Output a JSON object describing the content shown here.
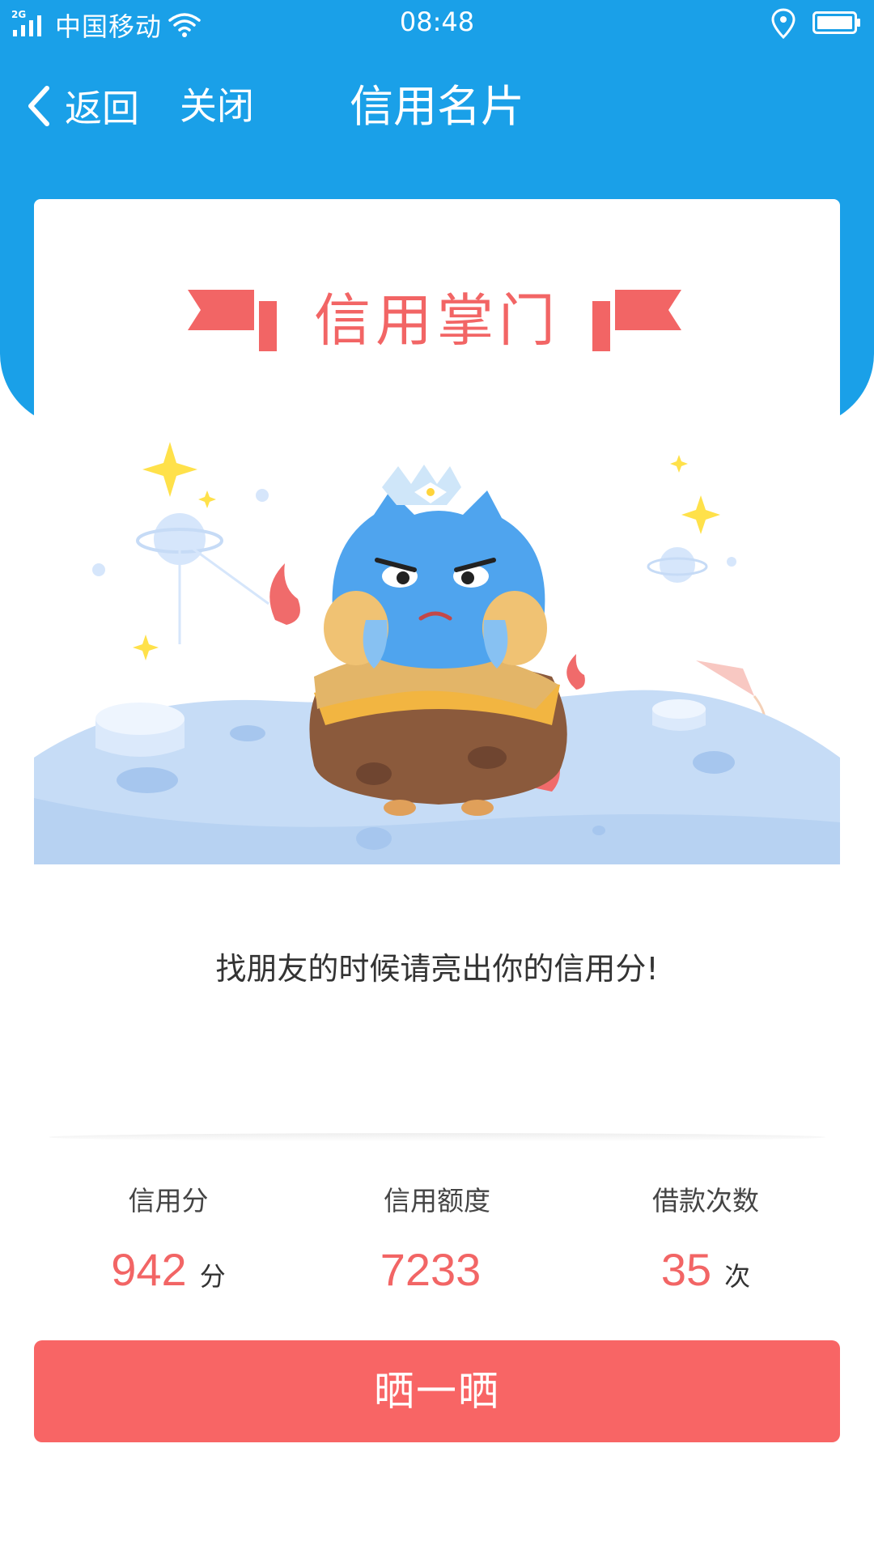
{
  "status_bar": {
    "network_tag": "2G",
    "carrier": "中国移动",
    "time": "08:48"
  },
  "nav": {
    "back_label": "返回",
    "close_label": "关闭",
    "title": "信用名片"
  },
  "card": {
    "title": "信用掌门",
    "slogan": "找朋友的时候请亮出你的信用分!"
  },
  "stats": [
    {
      "label": "信用分",
      "value": "942",
      "unit": "分"
    },
    {
      "label": "信用额度",
      "value": "7233",
      "unit": ""
    },
    {
      "label": "借款次数",
      "value": "35",
      "unit": "次"
    }
  ],
  "share_button": {
    "label": "晒一晒"
  },
  "colors": {
    "header_blue": "#1aa0e8",
    "accent_red": "#f26565",
    "button_red": "#f86565"
  }
}
